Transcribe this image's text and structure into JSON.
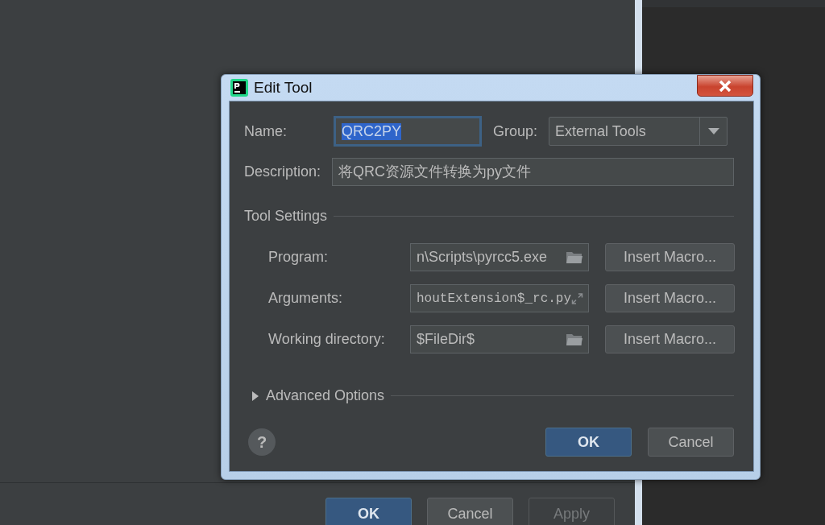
{
  "background": {
    "buttons": [
      {
        "label": "OK",
        "kind": "default",
        "disabled": false
      },
      {
        "label": "Cancel",
        "kind": "normal",
        "disabled": false
      },
      {
        "label": "Apply",
        "kind": "normal",
        "disabled": true
      }
    ]
  },
  "dialog": {
    "title": "Edit Tool",
    "name": {
      "label": "Name:",
      "value": "QRC2PY",
      "focused": true
    },
    "group": {
      "label": "Group:",
      "value": "External Tools"
    },
    "description": {
      "label": "Description:",
      "value": "将QRC资源文件转换为py文件"
    },
    "tool_settings": {
      "title": "Tool Settings",
      "fields": [
        {
          "label": "Program:",
          "value": "n\\Scripts\\pyrcc5.exe",
          "kind": "path",
          "button": "Insert Macro..."
        },
        {
          "label": "Arguments:",
          "value": "houtExtension$_rc.py",
          "kind": "args",
          "button": "Insert Macro..."
        },
        {
          "label": "Working directory:",
          "value": "$FileDir$",
          "kind": "path",
          "button": "Insert Macro..."
        }
      ]
    },
    "advanced": {
      "label": "Advanced Options",
      "expanded": false
    },
    "help": "?",
    "buttons": [
      {
        "label": "OK",
        "kind": "default"
      },
      {
        "label": "Cancel",
        "kind": "normal"
      }
    ]
  }
}
